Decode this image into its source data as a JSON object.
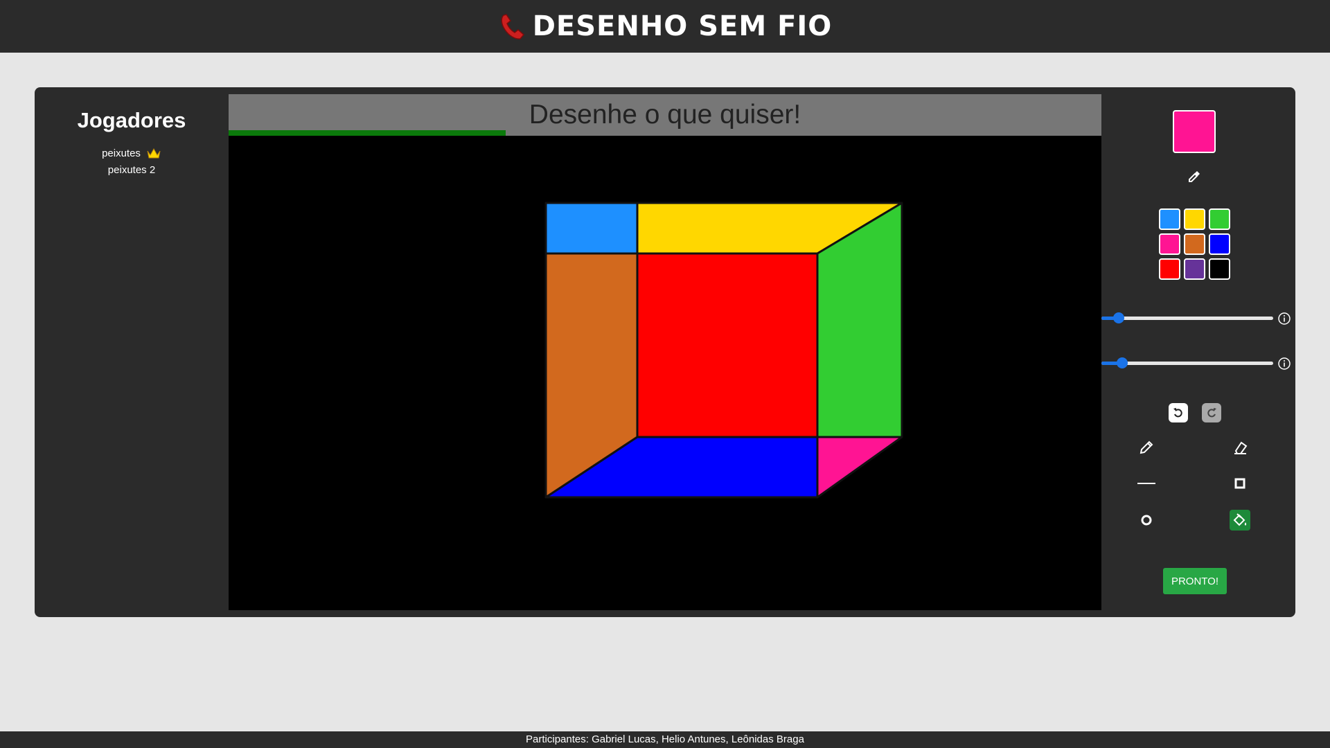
{
  "header": {
    "title": "DESENHO SEM FIO",
    "icon": "telephone-icon"
  },
  "players": {
    "title": "Jogadores",
    "list": [
      {
        "name": "peixutes",
        "is_host": true
      },
      {
        "name": "peixutes 2",
        "is_host": false
      }
    ]
  },
  "board": {
    "prompt": "Desenhe o que quiser!",
    "timer_fraction": 0.25,
    "background": "#000000"
  },
  "tools": {
    "current_color": "#ff1493",
    "palette": [
      "#1e90ff",
      "#ffd700",
      "#32cd32",
      "#ff1493",
      "#d2691e",
      "#0000ff",
      "#ff0000",
      "#663399",
      "#000000"
    ],
    "brush_size_fraction": 0.1,
    "opacity_fraction": 0.12,
    "active_tool": "fill-bucket",
    "done_label": "PRONTO!"
  },
  "footer": {
    "text": "Participantes: Gabriel Lucas, Helio Antunes, Leônidas Braga"
  }
}
